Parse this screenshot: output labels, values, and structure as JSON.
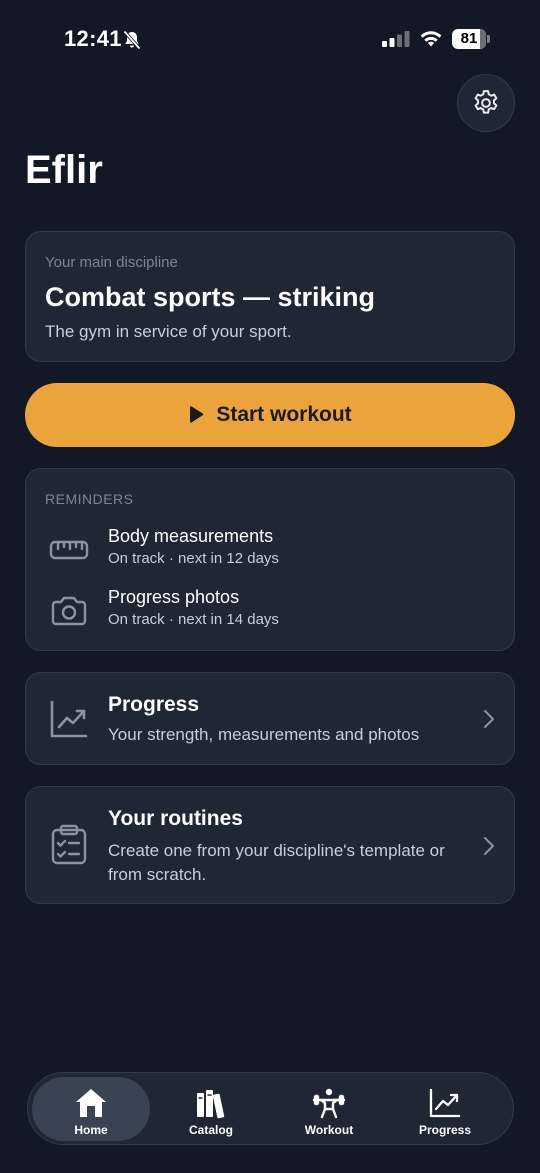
{
  "status_bar": {
    "time": "12:41",
    "battery": "81",
    "battery_fraction": 0.81
  },
  "header": {
    "title": "Eflir",
    "settings_icon": "gear-icon"
  },
  "discipline": {
    "label": "Your main discipline",
    "title": "Combat sports — striking",
    "subtitle": "The gym in service of your sport."
  },
  "start_button": {
    "label": "Start workout",
    "icon": "play-icon",
    "color": "#EBA43B"
  },
  "reminders": {
    "title": "REMINDERS",
    "items": [
      {
        "icon": "ruler-icon",
        "name": "Body measurements",
        "status": "On track · next in 12 days"
      },
      {
        "icon": "camera-icon",
        "name": "Progress photos",
        "status": "On track · next in 14 days"
      }
    ]
  },
  "nav_cards": [
    {
      "icon": "chart-icon",
      "title": "Progress",
      "subtitle": "Your strength, measurements and photos"
    },
    {
      "icon": "clipboard-checklist-icon",
      "title": "Your routines",
      "subtitle": "Create one from your discipline's template or from scratch."
    }
  ],
  "tab_bar": {
    "active": "Home",
    "tabs": [
      {
        "label": "Home",
        "icon": "home-icon"
      },
      {
        "label": "Catalog",
        "icon": "books-icon"
      },
      {
        "label": "Workout",
        "icon": "weightlifter-icon"
      },
      {
        "label": "Progress",
        "icon": "chart-icon"
      }
    ]
  },
  "colors": {
    "background": "#121825",
    "card": "#1F2734",
    "accent": "#EBA43B"
  }
}
